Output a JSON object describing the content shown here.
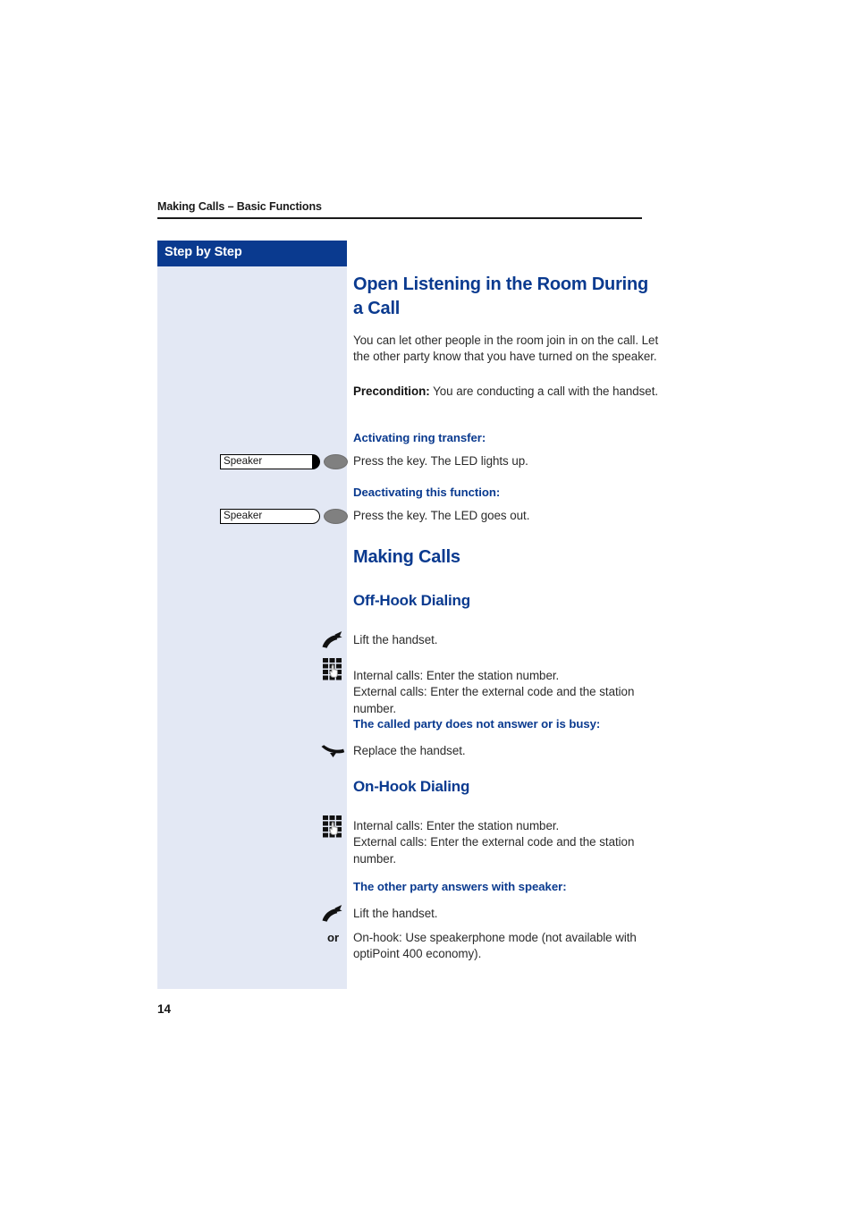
{
  "page": {
    "running_head": "Making Calls – Basic Functions",
    "folio": "14"
  },
  "sidebar": {
    "banner_label": "Step by Step",
    "keys": [
      {
        "label": "Speaker",
        "led_state": "lit",
        "icon": "speaker-key"
      },
      {
        "label": "Speaker",
        "led_state": "off",
        "icon": "speaker-key"
      }
    ],
    "margin_icons": [
      {
        "name": "lift-handset-icon",
        "for": "Lift the handset."
      },
      {
        "name": "keypad-icon",
        "for": "Enter the station number."
      },
      {
        "name": "replace-handset-icon",
        "for": "Replace the handset."
      },
      {
        "name": "keypad-icon",
        "for": "Enter the station number."
      },
      {
        "name": "lift-handset-icon",
        "for": "Lift the handset."
      }
    ],
    "or_label": "or"
  },
  "content": {
    "section_1": {
      "heading": "Open Listening in the Room During a Call",
      "intro": "You can let other people in the room join in on the call. Let the other party know that you have turned on the speaker.",
      "precondition_label": "Precondition:",
      "precondition_text": " You are conducting a call with the handset.",
      "step_1": {
        "heading": "Activating ring transfer:",
        "text": "Press the key. The LED lights up."
      },
      "step_2": {
        "heading": "Deactivating this function:",
        "text": "Press the key. The LED goes out."
      }
    },
    "section_2": {
      "heading": "Making Calls",
      "sub_1": {
        "heading": "Off-Hook Dialing",
        "step_1": "Lift the handset.",
        "step_2": "Internal calls: Enter the station number.\nExternal calls: Enter the external code and the station number.",
        "step_3_heading": "The called party does not answer or is busy:",
        "step_3": "Replace the handset."
      },
      "sub_2": {
        "heading": "On-Hook Dialing",
        "step_1": "Internal calls: Enter the station number.\nExternal calls: Enter the external code and the station number.",
        "step_2_heading": "The other party answers with speaker:",
        "step_2": "Lift the handset.",
        "step_3": "On-hook: Use speakerphone mode (not available with optiPoint 400 economy)."
      }
    }
  },
  "colors": {
    "accent_blue": "#0a3a8f",
    "sidebar_bg": "#e3e8f4",
    "body_text": "#2b2b2b",
    "key_led_on": "#000000",
    "key_bulb": "#808080"
  }
}
